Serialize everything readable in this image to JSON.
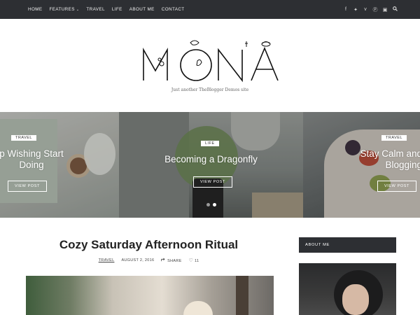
{
  "nav": {
    "items": [
      "HOME",
      "FEATURES",
      "TRAVEL",
      "LIFE",
      "ABOUT ME",
      "CONTACT"
    ],
    "social_icons": [
      "facebook-icon",
      "twitter-icon",
      "vine-icon",
      "pinterest-icon",
      "instagram-icon"
    ],
    "search_icon": "search-icon"
  },
  "site": {
    "logo_text": "MONA",
    "tagline": "Just another TheBlogger Demos site"
  },
  "slider": {
    "slides": [
      {
        "category": "TRAVEL",
        "title_line1": "p Wishing Start",
        "title_line2": "Doing",
        "button": "VIEW POST"
      },
      {
        "category": "LIFE",
        "title_line1": "Becoming a Dragonfly",
        "title_line2": "",
        "button": "VIEW POST"
      },
      {
        "category": "TRAVEL",
        "title_line1": "Stay Calm and",
        "title_line2": "Blogging",
        "button": "VIEW POST"
      }
    ],
    "dot_count": 2,
    "active_dot": 2
  },
  "post": {
    "title": "Cozy Saturday Afternoon Ritual",
    "category": "TRAVEL",
    "date": "AUGUST 2, 2016",
    "share_label": "SHARE",
    "likes": "11"
  },
  "sidebar": {
    "about_label": "ABOUT ME"
  },
  "colors": {
    "nav_bg": "#2d2f33",
    "white": "#ffffff",
    "text": "#222222"
  }
}
